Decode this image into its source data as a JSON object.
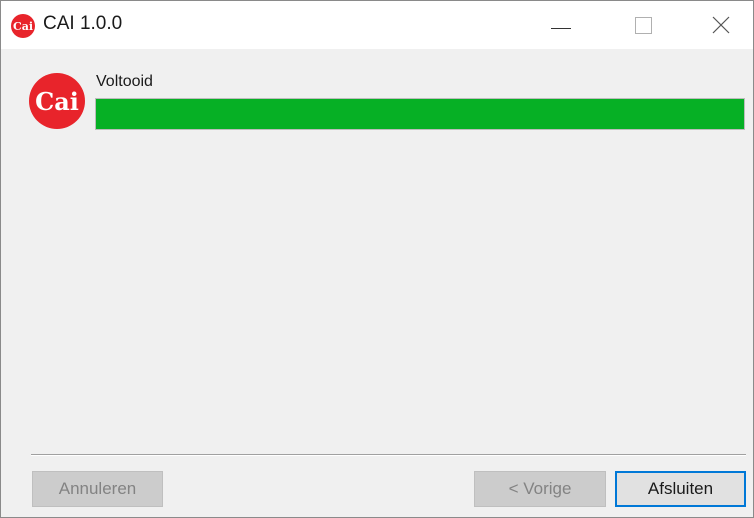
{
  "window": {
    "title": "CAI 1.0.0",
    "app_icon_text": "Cai",
    "controls": {
      "minimize_icon": "minimize-icon",
      "maximize_icon": "maximize-icon",
      "close_icon": "close-icon"
    }
  },
  "main": {
    "logo_text": "Cai",
    "status_label": "Voltooid",
    "progress_percent": 100,
    "progress_color": "#06b025"
  },
  "footer": {
    "cancel_label": "Annuleren",
    "cancel_enabled": false,
    "prev_label": "< Vorige",
    "prev_enabled": false,
    "finish_label": "Afsluiten",
    "finish_enabled": true
  },
  "colors": {
    "brand_red": "#e8242b",
    "accent_blue": "#0078d7"
  }
}
